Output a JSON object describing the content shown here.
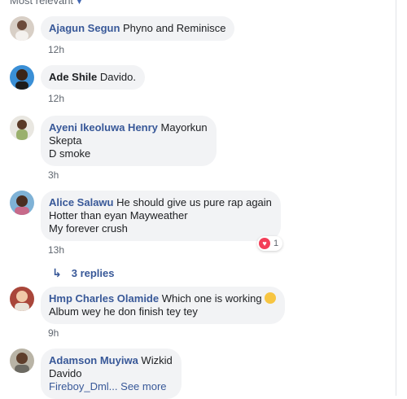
{
  "header": {
    "sort_label": "Most relevant"
  },
  "comments": [
    {
      "author": "Ajagun Segun",
      "lines": [
        "Phyno and Reminisce"
      ],
      "time": "12h"
    },
    {
      "author": "Ade Shile",
      "lines": [
        "Davido."
      ],
      "time": "12h"
    },
    {
      "author": "Ayeni Ikeoluwa Henry",
      "lines": [
        "Mayorkun",
        "Skepta",
        "D smoke"
      ],
      "time": "3h"
    },
    {
      "author": "Alice Salawu",
      "lines": [
        "He should give us pure rap again",
        "Hotter than eyan Mayweather",
        "My forever crush"
      ],
      "time": "13h",
      "reaction_count": "1",
      "replies_label": "3 replies"
    },
    {
      "author": "Hmp Charles Olamide",
      "lines": [
        "Which one is working",
        "Album wey he don finish tey tey"
      ],
      "time": "9h"
    },
    {
      "author": "Adamson Muyiwa",
      "lines": [
        "Wizkid",
        "Davido",
        "Fireboy_Dml..."
      ],
      "see_more": "See more"
    }
  ],
  "colors": {
    "link": "#385898",
    "bubble": "#f2f3f5",
    "meta": "#606770",
    "heart": "#f33e58"
  },
  "icons": {
    "sort": "caret-down-icon",
    "reaction": "heart-reaction-icon",
    "replies": "reply-arrow-icon",
    "emoji": "face-emoji-icon"
  }
}
